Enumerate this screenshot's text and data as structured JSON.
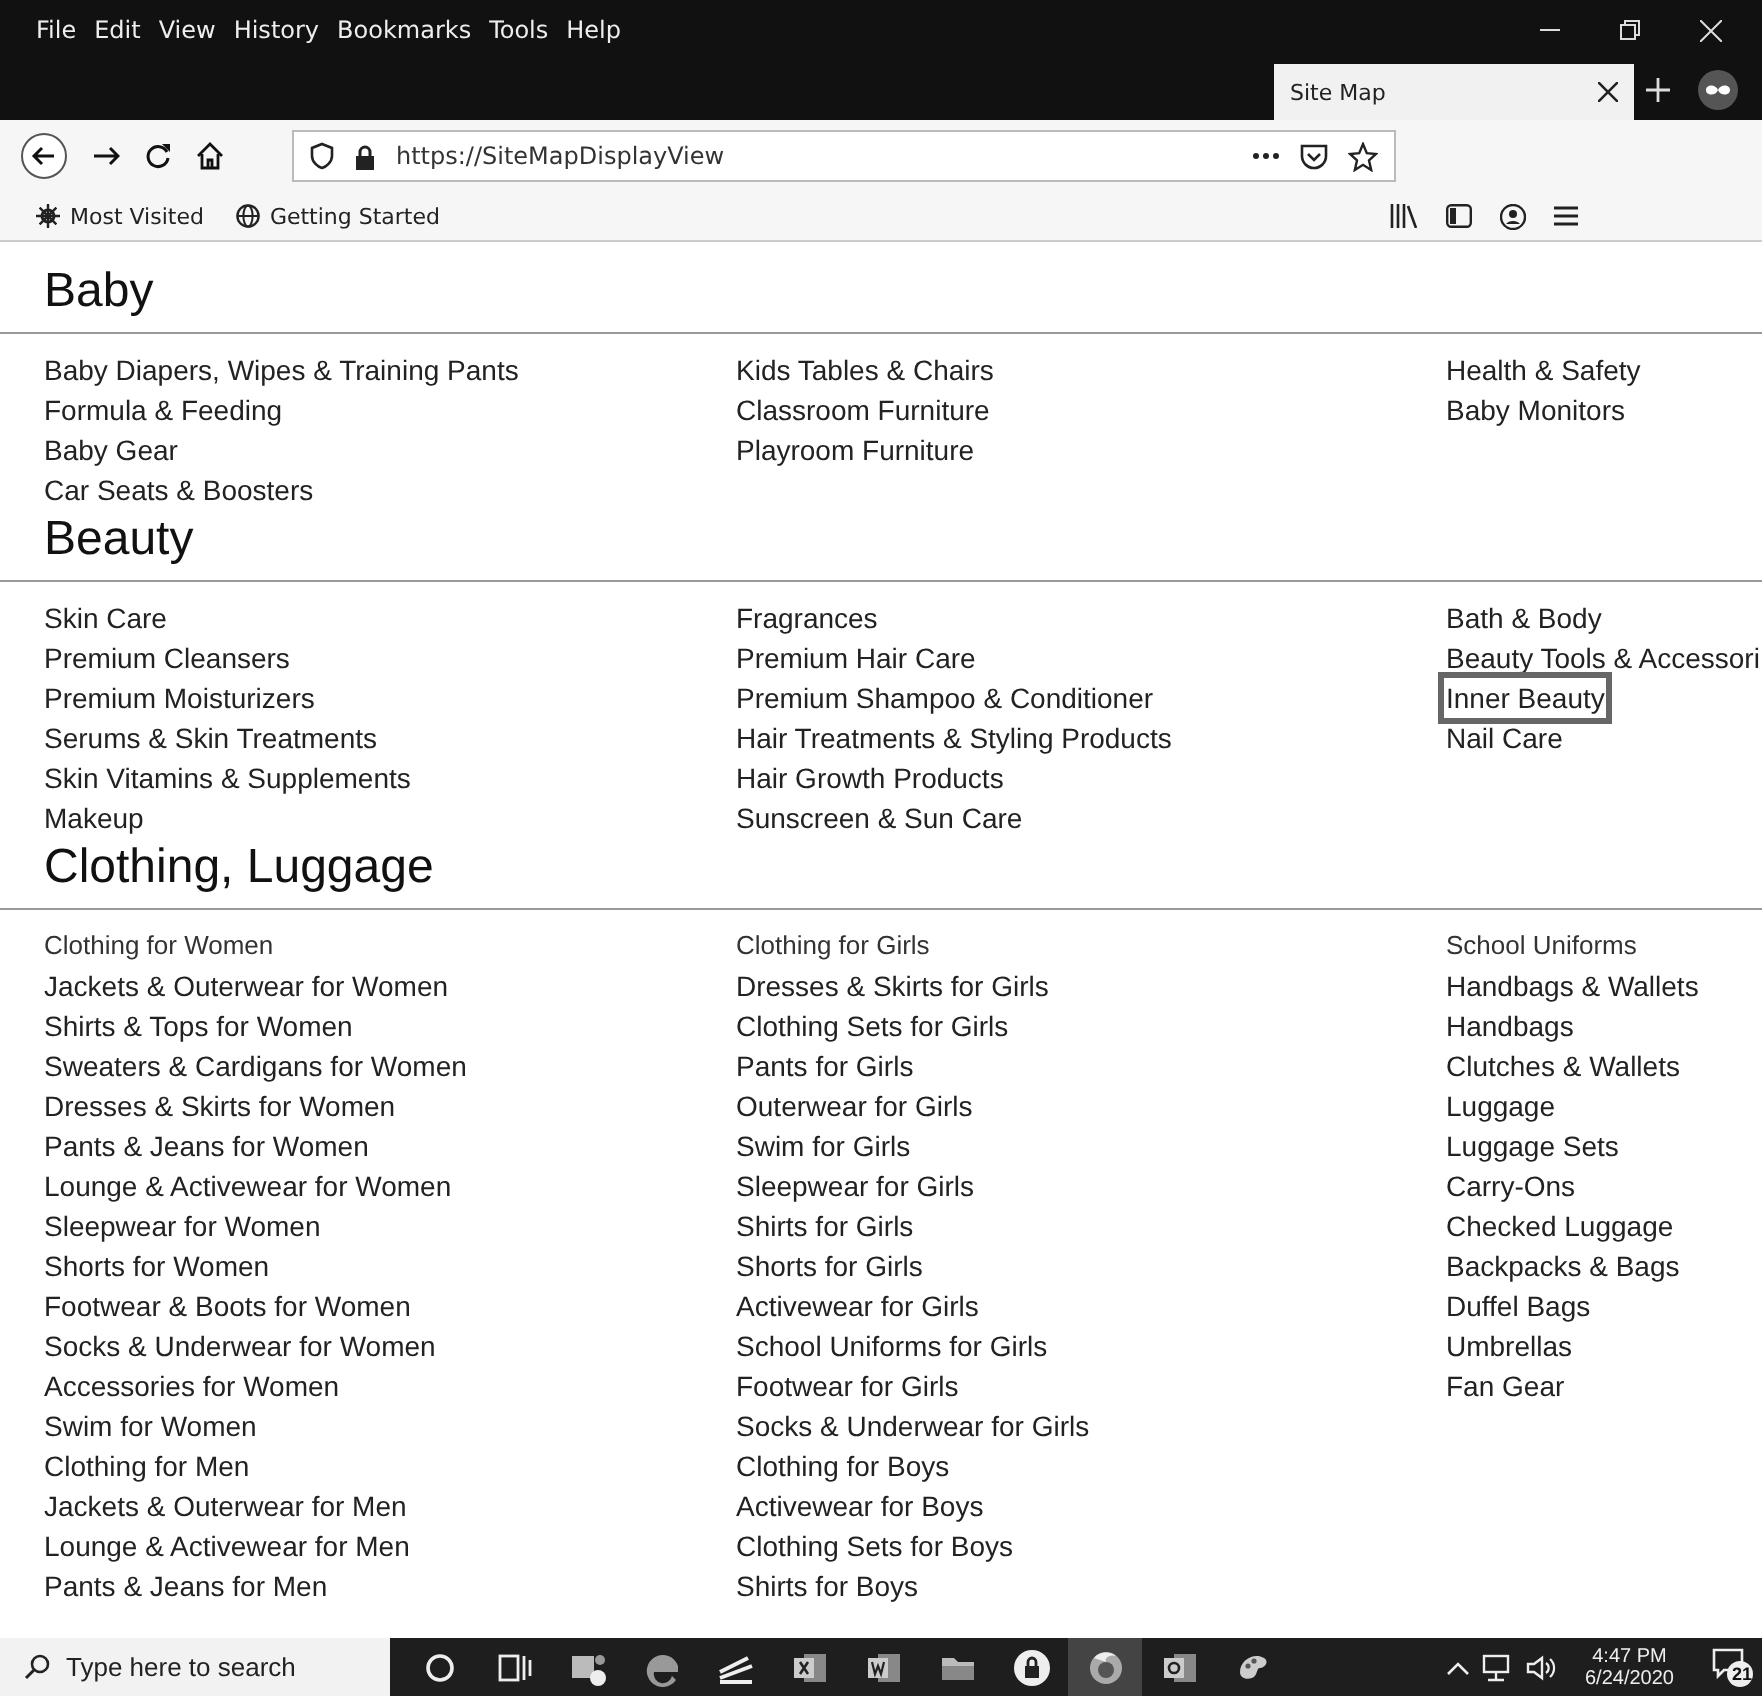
{
  "menu_bar": {
    "items": [
      "File",
      "Edit",
      "View",
      "History",
      "Bookmarks",
      "Tools",
      "Help"
    ]
  },
  "tab": {
    "title": "Site Map",
    "selected": true
  },
  "address_bar": {
    "url": "https://SiteMapDisplayView"
  },
  "bookmarks": [
    "Most Visited",
    "Getting Started"
  ],
  "sections": [
    {
      "title": "Baby",
      "columns": [
        {
          "links": [
            {
              "label": "Baby Diapers, Wipes & Training Pants",
              "highlighted": false
            },
            {
              "label": "Formula & Feeding",
              "highlighted": false
            },
            {
              "label": "Baby Gear",
              "highlighted": false
            },
            {
              "label": "Car Seats & Boosters",
              "highlighted": false
            }
          ]
        },
        {
          "links": [
            {
              "label": "Kids Tables & Chairs",
              "highlighted": false
            },
            {
              "label": "Classroom Furniture",
              "highlighted": false
            },
            {
              "label": "Playroom Furniture",
              "highlighted": false
            }
          ]
        },
        {
          "links": [
            {
              "label": "Health & Safety",
              "highlighted": false
            },
            {
              "label": "Baby Monitors",
              "highlighted": false
            }
          ]
        }
      ]
    },
    {
      "title": "Beauty",
      "columns": [
        {
          "links": [
            {
              "label": "Skin Care",
              "highlighted": false
            },
            {
              "label": "Premium Cleansers",
              "highlighted": false
            },
            {
              "label": "Premium Moisturizers",
              "highlighted": false
            },
            {
              "label": "Serums & Skin Treatments",
              "highlighted": false
            },
            {
              "label": "Skin Vitamins & Supplements",
              "highlighted": false
            },
            {
              "label": "Makeup",
              "highlighted": false
            }
          ]
        },
        {
          "links": [
            {
              "label": "Fragrances",
              "highlighted": false
            },
            {
              "label": "Premium Hair Care",
              "highlighted": false
            },
            {
              "label": "Premium Shampoo & Conditioner",
              "highlighted": false
            },
            {
              "label": "Hair Treatments & Styling Products",
              "highlighted": false
            },
            {
              "label": "Hair Growth Products",
              "highlighted": false
            },
            {
              "label": "Sunscreen & Sun Care",
              "highlighted": false
            }
          ]
        },
        {
          "links": [
            {
              "label": "Bath & Body",
              "highlighted": false
            },
            {
              "label": "Beauty Tools & Accessori",
              "highlighted": false
            },
            {
              "label": "Inner Beauty",
              "highlighted": true
            },
            {
              "label": "Nail Care",
              "highlighted": false
            }
          ]
        }
      ]
    },
    {
      "title": "Clothing, Luggage",
      "columns": [
        {
          "heading": "Clothing for Women",
          "links": [
            {
              "label": "Jackets & Outerwear for Women",
              "highlighted": false
            },
            {
              "label": "Shirts & Tops for Women",
              "highlighted": false
            },
            {
              "label": "Sweaters & Cardigans for Women",
              "highlighted": false
            },
            {
              "label": "Dresses & Skirts for Women",
              "highlighted": false
            },
            {
              "label": "Pants & Jeans for Women",
              "highlighted": false
            },
            {
              "label": "Lounge & Activewear for Women",
              "highlighted": false
            },
            {
              "label": "Sleepwear for Women",
              "highlighted": false
            },
            {
              "label": "Shorts for Women",
              "highlighted": false
            },
            {
              "label": "Footwear & Boots for Women",
              "highlighted": false
            },
            {
              "label": "Socks & Underwear for Women",
              "highlighted": false
            },
            {
              "label": "Accessories for Women",
              "highlighted": false
            },
            {
              "label": "Swim for Women",
              "highlighted": false
            },
            {
              "label": "Clothing for Men",
              "highlighted": false
            },
            {
              "label": "Jackets & Outerwear for Men",
              "highlighted": false
            },
            {
              "label": "Lounge & Activewear for Men",
              "highlighted": false
            },
            {
              "label": "Pants & Jeans for Men",
              "highlighted": false
            }
          ]
        },
        {
          "heading": "Clothing for Girls",
          "links": [
            {
              "label": "Dresses & Skirts for Girls",
              "highlighted": false
            },
            {
              "label": "Clothing Sets for Girls",
              "highlighted": false
            },
            {
              "label": "Pants for Girls",
              "highlighted": false
            },
            {
              "label": "Outerwear for Girls",
              "highlighted": false
            },
            {
              "label": "Swim for Girls",
              "highlighted": false
            },
            {
              "label": "Sleepwear for Girls",
              "highlighted": false
            },
            {
              "label": "Shirts for Girls",
              "highlighted": false
            },
            {
              "label": "Shorts for Girls",
              "highlighted": false
            },
            {
              "label": "Activewear for Girls",
              "highlighted": false
            },
            {
              "label": "School Uniforms for Girls",
              "highlighted": false
            },
            {
              "label": "Footwear for Girls",
              "highlighted": false
            },
            {
              "label": "Socks & Underwear for Girls",
              "highlighted": false
            },
            {
              "label": "Clothing for Boys",
              "highlighted": false
            },
            {
              "label": "Activewear for Boys",
              "highlighted": false
            },
            {
              "label": "Clothing Sets for Boys",
              "highlighted": false
            },
            {
              "label": "Shirts for Boys",
              "highlighted": false
            }
          ]
        },
        {
          "heading": "School Uniforms",
          "links": [
            {
              "label": "Handbags & Wallets",
              "highlighted": false
            },
            {
              "label": "Handbags",
              "highlighted": false
            },
            {
              "label": "Clutches & Wallets",
              "highlighted": false
            },
            {
              "label": "Luggage",
              "highlighted": false
            },
            {
              "label": "Luggage Sets",
              "highlighted": false
            },
            {
              "label": "Carry-Ons",
              "highlighted": false
            },
            {
              "label": "Checked Luggage",
              "highlighted": false
            },
            {
              "label": "Backpacks & Bags",
              "highlighted": false
            },
            {
              "label": "Duffel Bags",
              "highlighted": false
            },
            {
              "label": "Umbrellas",
              "highlighted": false
            },
            {
              "label": "Fan Gear",
              "highlighted": false
            }
          ]
        }
      ]
    }
  ],
  "taskbar": {
    "search_placeholder": "Type here to search",
    "time": "4:47 PM",
    "date": "6/24/2020",
    "notification_count": "21"
  }
}
